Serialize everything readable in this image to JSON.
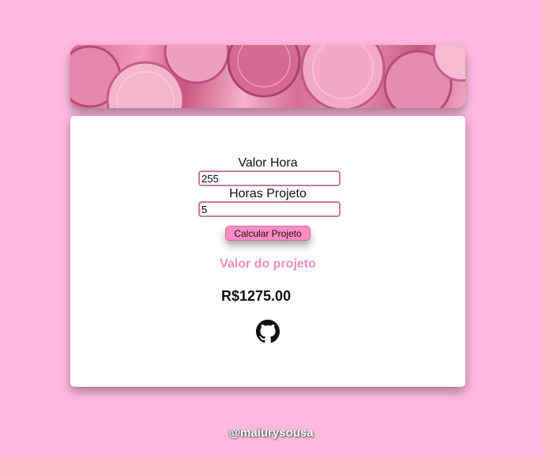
{
  "banner": {
    "alt": "coins"
  },
  "form": {
    "hour_label": "Valor Hora",
    "hour_value": "255",
    "hours_label": "Horas Projeto",
    "hours_value": "5",
    "calc_button": "Calcular Projeto"
  },
  "result": {
    "title": "Valor do projeto",
    "value": "R$1275.00"
  },
  "links": {
    "github_icon": "github-icon"
  },
  "footer": {
    "handle": "@maiurysousa"
  },
  "colors": {
    "page_bg": "#ffb9df",
    "button_bg": "#ff8cc6",
    "accent_text": "#f28dbe"
  }
}
